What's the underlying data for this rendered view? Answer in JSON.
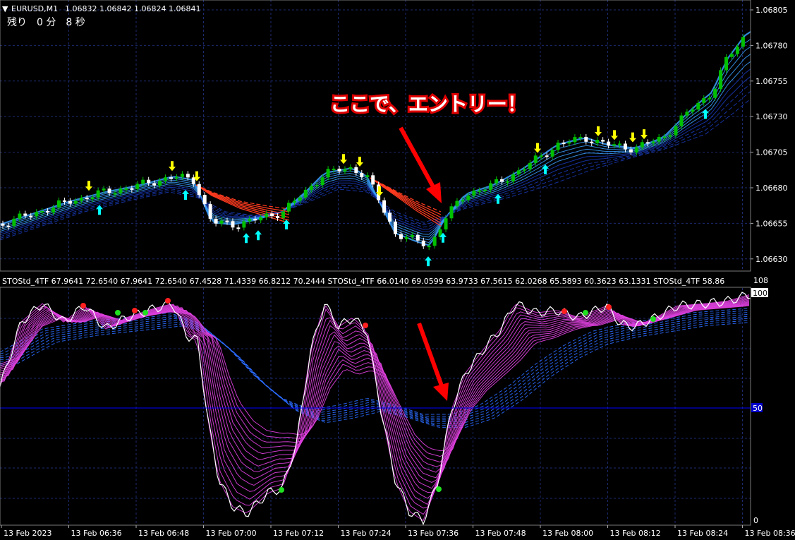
{
  "header": {
    "symbol": "EURUSD,M1",
    "ohlc": "1.06832 1.06842 1.06824 1.06841",
    "countdown": "残り　0 分　8 秒"
  },
  "annotation": {
    "text": "ここで、エントリー！"
  },
  "main_panel": {
    "price_axis": [
      "1.06805",
      "1.06780",
      "1.06755",
      "1.06730",
      "1.06705",
      "1.06680",
      "1.06655",
      "1.06630"
    ],
    "price_range": [
      1.06618,
      1.06812
    ]
  },
  "indicator_panel": {
    "legend": "STOStd_4TF 67.9641 72.6540 67.9641 72.6540 67.4528 71.4339 66.8212 70.2444   STOStd_4TF 66.0140 69.0599 63.9733 67.5615 62.0268 65.5893 60.3623 63.1331   STOStd_4TF 58.86",
    "axis_top": "108",
    "axis_100": "100",
    "axis_50": "50",
    "axis_0": "0"
  },
  "time_axis": [
    "13 Feb 2023",
    "13 Feb 06:36",
    "13 Feb 06:48",
    "13 Feb 07:00",
    "13 Feb 07:12",
    "13 Feb 07:24",
    "13 Feb 07:36",
    "13 Feb 07:48",
    "13 Feb 08:00",
    "13 Feb 08:12",
    "13 Feb 08:24",
    "13 Feb 08:36"
  ],
  "colors": {
    "background": "#000000",
    "grid": "#1c2a6e",
    "bull_candle": "#00c000",
    "bear_candle": "#ffffff",
    "ribbon_up": "#3aa0ff",
    "ribbon_down": "#ff3b1f",
    "stoch_main": "#ffffff",
    "stoch_ribbon": "#e040e0",
    "stoch_slow": "#2b6cff",
    "level_line": "#0000ff",
    "arrow_up": "#00ffff",
    "arrow_down": "#ffff00",
    "callout_arrow": "#ff0000"
  }
}
